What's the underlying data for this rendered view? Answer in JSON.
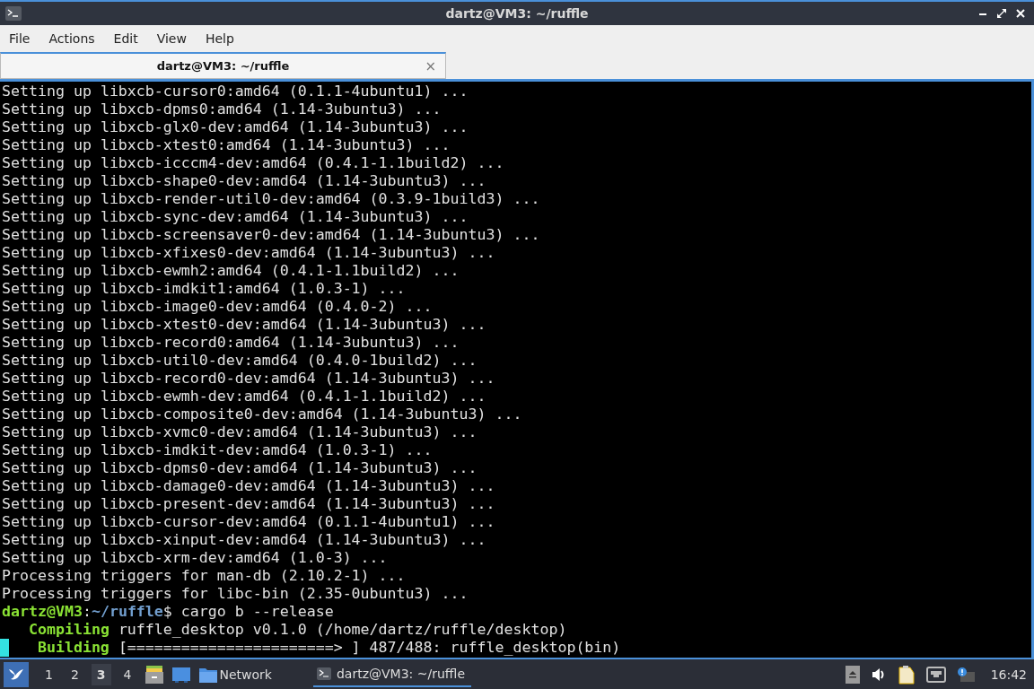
{
  "window": {
    "title": "dartz@VM3: ~/ruffle"
  },
  "menu": [
    "File",
    "Actions",
    "Edit",
    "View",
    "Help"
  ],
  "tabs": [
    {
      "label": "dartz@VM3: ~/ruffle",
      "selected": true,
      "close": "×"
    }
  ],
  "terminal": {
    "lines": [
      {
        "kind": "plain",
        "text": "Setting up libxcb-cursor0:amd64 (0.1.1-4ubuntu1) ..."
      },
      {
        "kind": "plain",
        "text": "Setting up libxcb-dpms0:amd64 (1.14-3ubuntu3) ..."
      },
      {
        "kind": "plain",
        "text": "Setting up libxcb-glx0-dev:amd64 (1.14-3ubuntu3) ..."
      },
      {
        "kind": "plain",
        "text": "Setting up libxcb-xtest0:amd64 (1.14-3ubuntu3) ..."
      },
      {
        "kind": "plain",
        "text": "Setting up libxcb-icccm4-dev:amd64 (0.4.1-1.1build2) ..."
      },
      {
        "kind": "plain",
        "text": "Setting up libxcb-shape0-dev:amd64 (1.14-3ubuntu3) ..."
      },
      {
        "kind": "plain",
        "text": "Setting up libxcb-render-util0-dev:amd64 (0.3.9-1build3) ..."
      },
      {
        "kind": "plain",
        "text": "Setting up libxcb-sync-dev:amd64 (1.14-3ubuntu3) ..."
      },
      {
        "kind": "plain",
        "text": "Setting up libxcb-screensaver0-dev:amd64 (1.14-3ubuntu3) ..."
      },
      {
        "kind": "plain",
        "text": "Setting up libxcb-xfixes0-dev:amd64 (1.14-3ubuntu3) ..."
      },
      {
        "kind": "plain",
        "text": "Setting up libxcb-ewmh2:amd64 (0.4.1-1.1build2) ..."
      },
      {
        "kind": "plain",
        "text": "Setting up libxcb-imdkit1:amd64 (1.0.3-1) ..."
      },
      {
        "kind": "plain",
        "text": "Setting up libxcb-image0-dev:amd64 (0.4.0-2) ..."
      },
      {
        "kind": "plain",
        "text": "Setting up libxcb-xtest0-dev:amd64 (1.14-3ubuntu3) ..."
      },
      {
        "kind": "plain",
        "text": "Setting up libxcb-record0:amd64 (1.14-3ubuntu3) ..."
      },
      {
        "kind": "plain",
        "text": "Setting up libxcb-util0-dev:amd64 (0.4.0-1build2) ..."
      },
      {
        "kind": "plain",
        "text": "Setting up libxcb-record0-dev:amd64 (1.14-3ubuntu3) ..."
      },
      {
        "kind": "plain",
        "text": "Setting up libxcb-ewmh-dev:amd64 (0.4.1-1.1build2) ..."
      },
      {
        "kind": "plain",
        "text": "Setting up libxcb-composite0-dev:amd64 (1.14-3ubuntu3) ..."
      },
      {
        "kind": "plain",
        "text": "Setting up libxcb-xvmc0-dev:amd64 (1.14-3ubuntu3) ..."
      },
      {
        "kind": "plain",
        "text": "Setting up libxcb-imdkit-dev:amd64 (1.0.3-1) ..."
      },
      {
        "kind": "plain",
        "text": "Setting up libxcb-dpms0-dev:amd64 (1.14-3ubuntu3) ..."
      },
      {
        "kind": "plain",
        "text": "Setting up libxcb-damage0-dev:amd64 (1.14-3ubuntu3) ..."
      },
      {
        "kind": "plain",
        "text": "Setting up libxcb-present-dev:amd64 (1.14-3ubuntu3) ..."
      },
      {
        "kind": "plain",
        "text": "Setting up libxcb-cursor-dev:amd64 (0.1.1-4ubuntu1) ..."
      },
      {
        "kind": "plain",
        "text": "Setting up libxcb-xinput-dev:amd64 (1.14-3ubuntu3) ..."
      },
      {
        "kind": "plain",
        "text": "Setting up libxcb-xrm-dev:amd64 (1.0-3) ..."
      },
      {
        "kind": "plain",
        "text": "Processing triggers for man-db (2.10.2-1) ..."
      },
      {
        "kind": "plain",
        "text": "Processing triggers for libc-bin (2.35-0ubuntu3) ..."
      },
      {
        "kind": "prompt",
        "user_host": "dartz@VM3",
        "separator": ":",
        "path": "~/ruffle",
        "symbol": "$",
        "command": "cargo b --release"
      },
      {
        "kind": "cargo",
        "status": "Compiling",
        "message": "ruffle_desktop v0.1.0 (/home/dartz/ruffle/desktop)",
        "cursor": false
      },
      {
        "kind": "cargo",
        "status": "Building",
        "message": "[=======================> ] 487/488: ruffle_desktop(bin)",
        "cursor": true
      }
    ]
  },
  "taskbar": {
    "workspaces": [
      {
        "label": "1",
        "selected": false
      },
      {
        "label": "2",
        "selected": false
      },
      {
        "label": "3",
        "selected": true
      },
      {
        "label": "4",
        "selected": false
      }
    ],
    "launchers": [
      {
        "kind": "folder",
        "label": "Network"
      }
    ],
    "tasks": [
      {
        "label": "dartz@VM3: ~/ruffle",
        "selected": true
      }
    ],
    "clock": "16:42"
  }
}
